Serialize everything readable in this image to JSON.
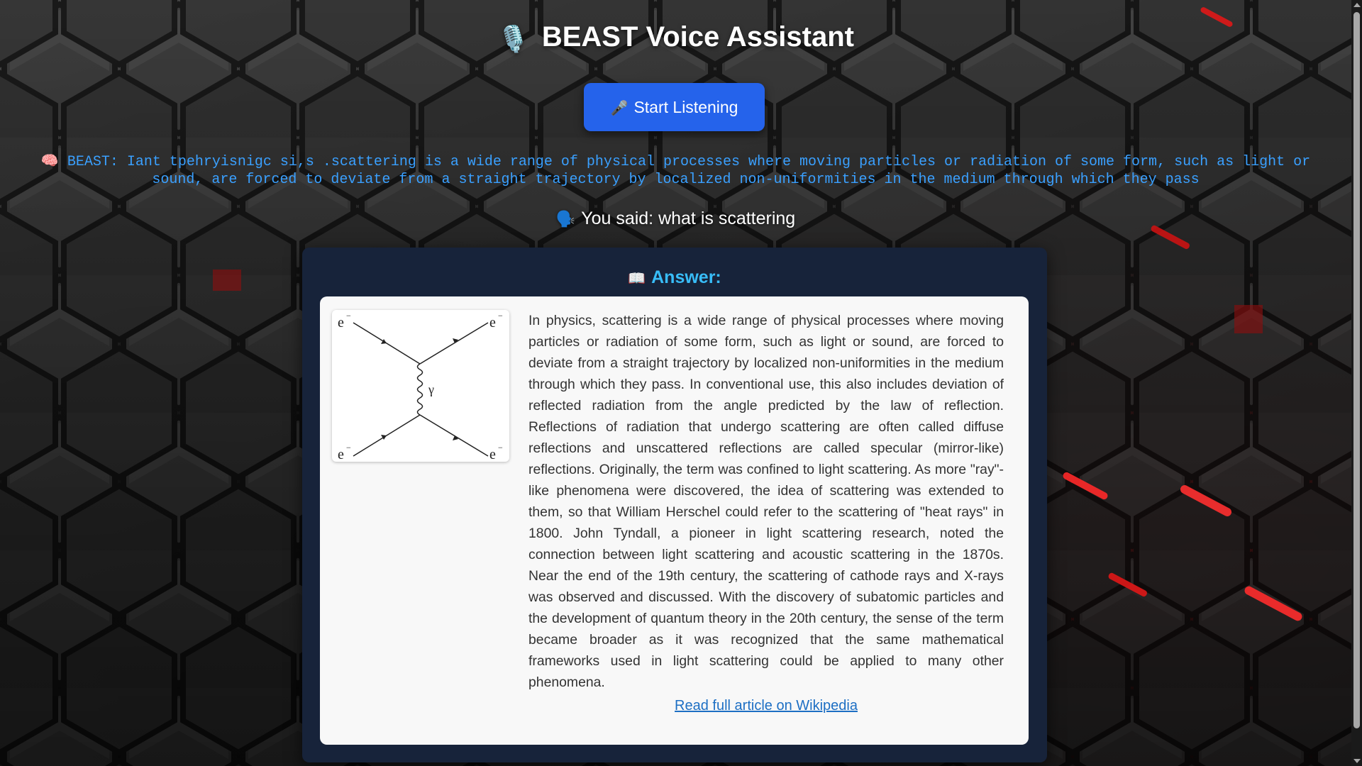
{
  "header": {
    "icon": "studio-microphone-icon",
    "icon_glyph": "🎙️",
    "title": "BEAST Voice Assistant"
  },
  "controls": {
    "start_icon": "microphone-icon",
    "start_icon_glyph": "🎤",
    "start_label": "Start Listening"
  },
  "assistant_output": {
    "icon": "brain-icon",
    "icon_glyph": "🧠",
    "text": "BEAST: Iant tpehryisnigc si,s .scattering is a wide range of physical processes where moving particles or radiation of some form, such as light or sound, are forced to deviate from a straight trajectory by localized non-uniformities in the medium through which they pass"
  },
  "transcript": {
    "icon": "speaking-head-icon",
    "icon_glyph": "🗣️",
    "text": "You said: what is scattering"
  },
  "answer": {
    "heading_icon": "open-book-icon",
    "heading_icon_glyph": "📖",
    "heading": "Answer:",
    "diagram": {
      "particle_label": "e",
      "charge_label": "−",
      "boson_label": "γ"
    },
    "body": "In physics, scattering is a wide range of physical processes where moving particles or radiation of some form, such as light or sound, are forced to deviate from a straight trajectory by localized non-uniformities in the medium through which they pass. In conventional use, this also includes deviation of reflected radiation from the angle predicted by the law of reflection. Reflections of radiation that undergo scattering are often called diffuse reflections and unscattered reflections are called specular (mirror-like) reflections. Originally, the term was confined to light scattering. As more \"ray\"-like phenomena were discovered, the idea of scattering was extended to them, so that William Herschel could refer to the scattering of \"heat rays\" in 1800. John Tyndall, a pioneer in light scattering research, noted the connection between light scattering and acoustic scattering in the 1870s. Near the end of the 19th century, the scattering of cathode rays and X-rays was observed and discussed. With the discovery of subatomic particles and the development of quantum theory in the 20th century, the sense of the term became broader as it was recognized that the same mathematical frameworks used in light scattering could be applied to many other phenomena.",
    "link_text": "Read full article on Wikipedia"
  },
  "colors": {
    "accent_button": "#2563eb",
    "assistant_text": "#3aa0ff",
    "answer_heading": "#38bdf8",
    "panel_bg": "#17233a",
    "link": "#1d6fc4"
  }
}
